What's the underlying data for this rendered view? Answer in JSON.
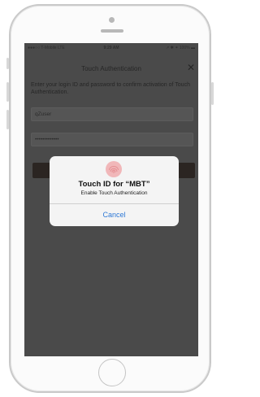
{
  "status_bar": {
    "carrier": "●●●○○ T-Mobile  LTE",
    "time": "9:29 AM",
    "battery": "↗ ✱ ✶ 100% ▬"
  },
  "header": {
    "title": "Touch Authentication",
    "close_icon": "✕"
  },
  "form": {
    "instructions": "Enter your login ID and password to confirm activation of Touch Authentication.",
    "username_value": "qZuser",
    "password_value": "•••••••••••••"
  },
  "touch_id_dialog": {
    "icon": "fingerprint-icon",
    "title": "Touch ID for “MBT”",
    "subtitle": "Enable Touch Authentication",
    "cancel_label": "Cancel"
  },
  "colors": {
    "overlay": "#4a4a4a",
    "dialog_background": "#f4f4f4",
    "cancel_blue": "#2f79d6",
    "fingerprint_pink": "#f1b7b9"
  }
}
